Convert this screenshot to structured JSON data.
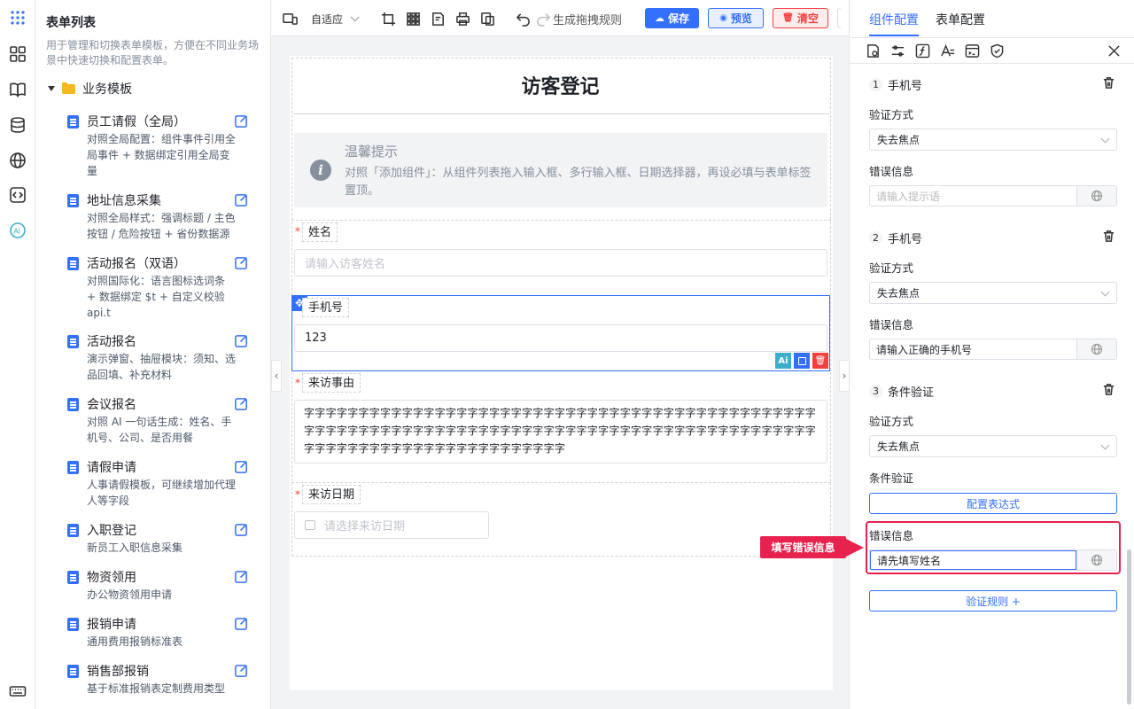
{
  "sidebar": {
    "title": "表单列表",
    "description": "用于管理和切换表单模板，方便在不同业务场景中快速切换和配置表单。",
    "folder": "业务模板",
    "templates": [
      {
        "title": "员工请假（全局）",
        "desc": "对照全局配置：组件事件引用全局事件 + 数据绑定引用全局变量"
      },
      {
        "title": "地址信息采集",
        "desc": "对照全局样式：强调标题 / 主色按钮 / 危险按钮 + 省份数据源"
      },
      {
        "title": "活动报名（双语）",
        "desc": "对照国际化：语言图标选词条 + 数据绑定 $t + 自定义校验 api.t"
      },
      {
        "title": "活动报名",
        "desc": "演示弹窗、抽屉模块：须知、选品回填、补充材料"
      },
      {
        "title": "会议报名",
        "desc": "对照 AI 一句话生成：姓名、手机号、公司、是否用餐"
      },
      {
        "title": "请假申请",
        "desc": "人事请假模板，可继续增加代理人等字段"
      },
      {
        "title": "入职登记",
        "desc": "新员工入职信息采集"
      },
      {
        "title": "物资领用",
        "desc": "办公物资领用申请"
      },
      {
        "title": "报销申请",
        "desc": "通用费用报销标准表"
      },
      {
        "title": "销售部报销",
        "desc": "基于标准报销表定制费用类型"
      }
    ]
  },
  "toolbar": {
    "layout_mode": "自适应",
    "generate_label": "生成拖拽规则",
    "save_label": "保存",
    "preview_label": "预览",
    "clear_label": "清空"
  },
  "form": {
    "title": "访客登记",
    "notice_title": "温馨提示",
    "notice_text": "对照「添加组件」：从组件列表拖入输入框、多行输入框、日期选择器，再设必填与表单标签置顶。",
    "fields": {
      "name_label": "姓名",
      "name_placeholder": "请输入访客姓名",
      "phone_label": "手机号",
      "phone_value": "123",
      "reason_label": "来访事由",
      "reason_value": "字字字字字字字字字字字字字字字字字字字字字字字字字字字字字字字字字字字字字字字字字字字字字字字字字字字字字字字字字字字字字字字字字字字字字字字字字字字字字字字字字字字字字字字字字字字字字字字字字字字字字字字字字字字字字字字字字字字字字字",
      "date_label": "来访日期",
      "date_placeholder": "请选择来访日期"
    },
    "required_mark": "*",
    "ai_badge": "Ai"
  },
  "config": {
    "tab_component": "组件配置",
    "tab_form": "表单配置",
    "rules": [
      {
        "num": "1",
        "title": "手机号",
        "method_label": "验证方式",
        "method_value": "失去焦点",
        "error_label": "错误信息",
        "error_value": "",
        "error_placeholder": "请输入提示语"
      },
      {
        "num": "2",
        "title": "手机号",
        "method_label": "验证方式",
        "method_value": "失去焦点",
        "error_label": "错误信息",
        "error_value": "请输入正确的手机号"
      },
      {
        "num": "3",
        "title": "条件验证",
        "method_label": "验证方式",
        "method_value": "失去焦点",
        "cond_label": "条件验证",
        "cond_button": "配置表达式",
        "error_label": "错误信息",
        "error_value": "请先填写姓名"
      }
    ],
    "tooltip": "填写错误信息",
    "add_rule_button": "验证规则 +",
    "colors": {
      "accent": "#3370ff",
      "highlight": "#e8224f",
      "danger": "#f53f3f"
    }
  }
}
